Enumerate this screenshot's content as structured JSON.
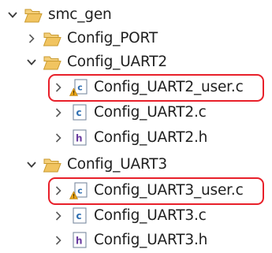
{
  "tree": {
    "root": {
      "label": "smc_gen",
      "icon": "folder-open-icon",
      "expanded": true
    },
    "config_port": {
      "label": "Config_PORT",
      "icon": "folder-icon",
      "expanded": false
    },
    "config_uart2": {
      "label": "Config_UART2",
      "icon": "folder-open-icon",
      "expanded": true,
      "files": [
        {
          "label": "Config_UART2_user.c",
          "icon": "c-file-warning-icon",
          "highlighted": true
        },
        {
          "label": "Config_UART2.c",
          "icon": "c-file-icon",
          "highlighted": false
        },
        {
          "label": "Config_UART2.h",
          "icon": "h-file-icon",
          "highlighted": false
        }
      ]
    },
    "config_uart3": {
      "label": "Config_UART3",
      "icon": "folder-open-icon",
      "expanded": true,
      "files": [
        {
          "label": "Config_UART3_user.c",
          "icon": "c-file-warning-icon",
          "highlighted": true
        },
        {
          "label": "Config_UART3.c",
          "icon": "c-file-icon",
          "highlighted": false
        },
        {
          "label": "Config_UART3.h",
          "icon": "h-file-icon",
          "highlighted": false
        }
      ]
    }
  },
  "colors": {
    "highlight": "#e8202a",
    "folder": "#e8b74e",
    "c_file": "#2b6cb0",
    "h_file": "#6a3ca0",
    "warning": "#e8a317"
  }
}
